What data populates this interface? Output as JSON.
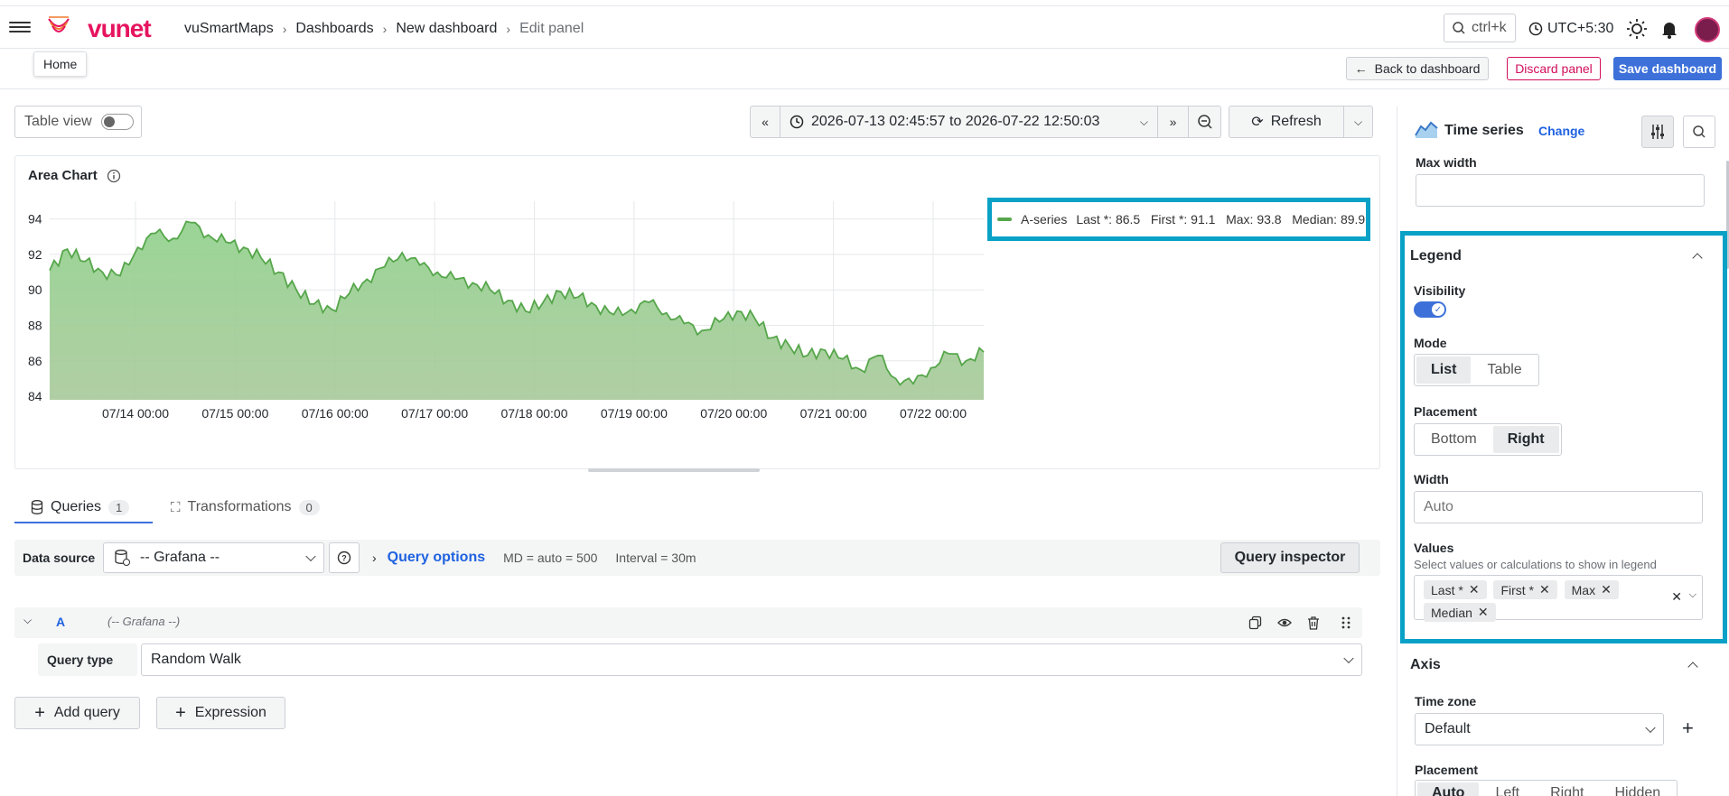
{
  "brand": {
    "name": "vunet",
    "accent": "#e6145f"
  },
  "breadcrumb": [
    "vuSmartMaps",
    "Dashboards",
    "New dashboard",
    "Edit panel"
  ],
  "search": {
    "shortcut": "ctrl+k"
  },
  "timezone": "UTC+5:30",
  "tooltip": "Home",
  "actions": {
    "back": "Back to dashboard",
    "discard": "Discard panel",
    "save": "Save dashboard"
  },
  "tableview": {
    "label": "Table view",
    "enabled": false
  },
  "timepicker": {
    "range": "2026-07-13 02:45:57 to 2026-07-22 12:50:03",
    "refresh": "Refresh"
  },
  "panel": {
    "title": "Area Chart"
  },
  "legend": {
    "series": "A-series",
    "stats": "Last *: 86.5   First *: 91.1   Max: 93.8   Median: 89.9"
  },
  "chart_data": {
    "type": "area",
    "title": "Area Chart",
    "xlabel": "",
    "ylabel": "",
    "ylim": [
      83.8,
      95
    ],
    "yticks": [
      94,
      92,
      90,
      88,
      86,
      84
    ],
    "categories": [
      "07/14 00:00",
      "07/15 00:00",
      "07/16 00:00",
      "07/17 00:00",
      "07/18 00:00",
      "07/19 00:00",
      "07/20 00:00",
      "07/21 00:00",
      "07/22 00:00"
    ],
    "series": [
      {
        "name": "A-series",
        "color": "#56a64b",
        "values": [
          91.1,
          92.3,
          91.6,
          91.0,
          90.8,
          92.4,
          93.2,
          92.9,
          93.8,
          93.1,
          92.7,
          92.4,
          91.8,
          91.0,
          90.0,
          89.2,
          88.9,
          89.8,
          90.6,
          91.3,
          92.1,
          91.4,
          91.0,
          90.6,
          90.4,
          90.0,
          89.4,
          88.8,
          89.3,
          89.9,
          89.6,
          89.1,
          88.6,
          88.9,
          89.3,
          88.7,
          88.1,
          87.7,
          88.2,
          88.8,
          88.4,
          87.3,
          86.8,
          86.3,
          86.6,
          86.1,
          85.5,
          86.3,
          85.0,
          84.7,
          85.6,
          86.4,
          86.0,
          86.5
        ]
      }
    ],
    "grid": true,
    "legend_placement": "right"
  },
  "tabs": {
    "queries": "Queries",
    "queries_count": "1",
    "transformations": "Transformations",
    "transformations_count": "0"
  },
  "querybar": {
    "datasource_label": "Data source",
    "datasource_value": "-- Grafana --",
    "options": "Query options",
    "md": "MD = auto = 500",
    "interval": "Interval = 30m",
    "inspector": "Query inspector"
  },
  "query": {
    "ref": "A",
    "source": "(-- Grafana --)",
    "type_label": "Query type",
    "type_value": "Random Walk"
  },
  "add": {
    "query": "Add query",
    "expression": "Expression"
  },
  "side": {
    "viz": "Time series",
    "change": "Change",
    "maxwidth_label": "Max width",
    "legend_title": "Legend",
    "visibility_label": "Visibility",
    "mode_label": "Mode",
    "mode_options": [
      "List",
      "Table"
    ],
    "mode_selected": "List",
    "placement_label": "Placement",
    "placement_options": [
      "Bottom",
      "Right"
    ],
    "placement_selected": "Right",
    "width_label": "Width",
    "width_placeholder": "Auto",
    "values_label": "Values",
    "values_help": "Select values or calculations to show in legend",
    "values_chips": [
      "Last *",
      "First *",
      "Max",
      "Median"
    ],
    "axis_title": "Axis",
    "timezone_label": "Time zone",
    "timezone_value": "Default",
    "axis_placement_label": "Placement",
    "axis_placement_options": [
      "Auto",
      "Left",
      "Right",
      "Hidden"
    ]
  }
}
